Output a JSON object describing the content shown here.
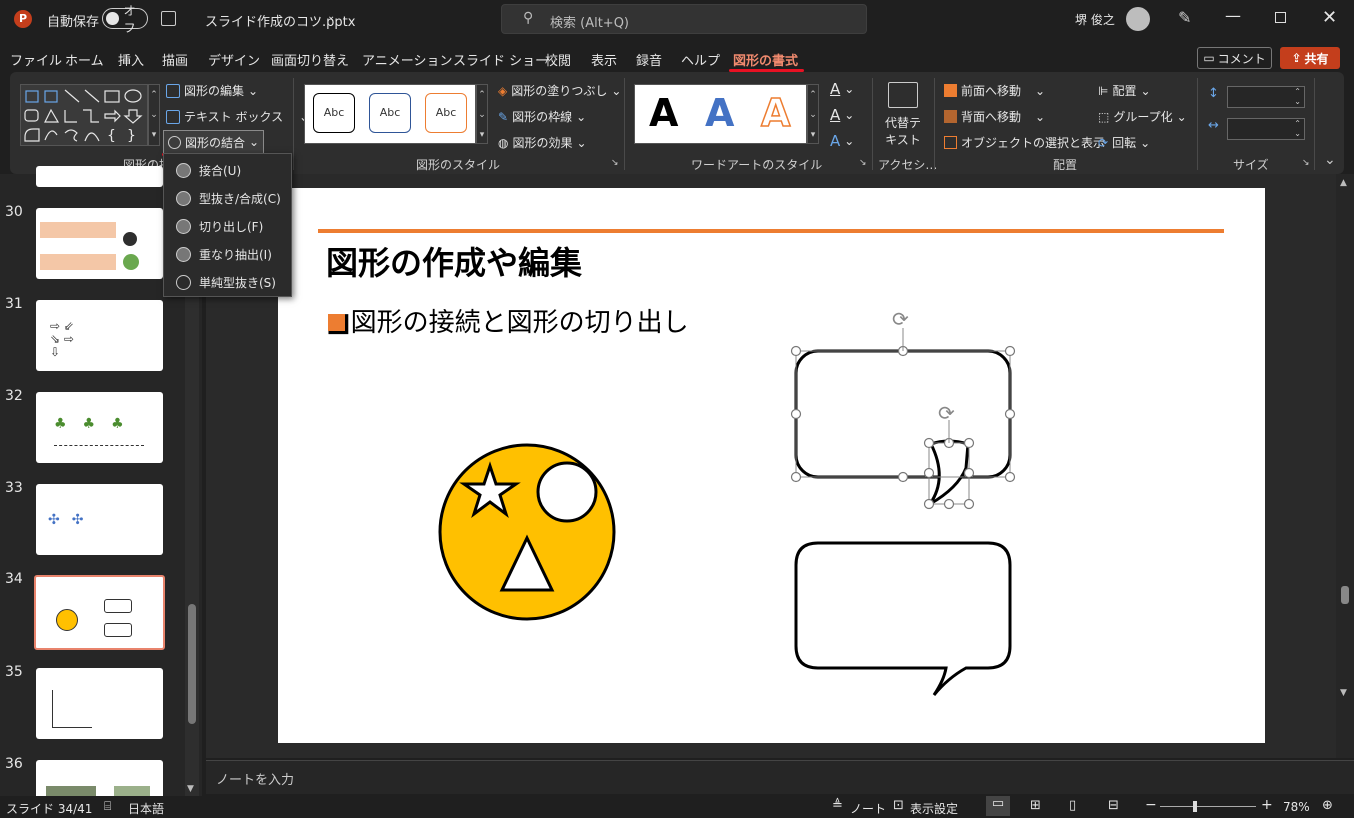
{
  "titlebar": {
    "autosave_label": "自動保存",
    "autosave_toggle": "オフ",
    "filename": "スライド作成のコツ.pptx",
    "search_placeholder": "検索 (Alt+Q)",
    "user_name": "堺 俊之"
  },
  "menu": {
    "tabs": [
      "ファイル",
      "ホーム",
      "挿入",
      "描画",
      "デザイン",
      "画面切り替え",
      "アニメーション",
      "スライド ショー",
      "校閲",
      "表示",
      "録音",
      "ヘルプ",
      "図形の書式"
    ],
    "comment_label": "コメント",
    "share_label": "共有"
  },
  "ribbon": {
    "insert_shapes": {
      "edit_shape": "図形の編集",
      "text_box": "テキスト ボックス",
      "merge_shapes": "図形の結合",
      "group_label": "図形の挿入"
    },
    "shape_styles": {
      "abc": "Abc",
      "fill": "図形の塗りつぶし",
      "outline": "図形の枠線",
      "effects": "図形の効果",
      "group_label": "図形のスタイル"
    },
    "wordart": {
      "letter": "A",
      "group_label": "ワードアートのスタイル"
    },
    "accessibility": {
      "alt_text_line1": "代替テ",
      "alt_text_line2": "キスト",
      "group_label": "アクセシ…"
    },
    "arrange": {
      "bring_forward": "前面へ移動",
      "send_backward": "背面へ移動",
      "selection_pane": "オブジェクトの選択と表示",
      "align": "配置",
      "group": "グループ化",
      "rotate": "回転",
      "group_label": "配置"
    },
    "size": {
      "group_label": "サイズ"
    }
  },
  "dropdown": {
    "items": [
      "接合(U)",
      "型抜き/合成(C)",
      "切り出し(F)",
      "重なり抽出(I)",
      "単純型抜き(S)"
    ]
  },
  "thumbnails": {
    "numbers": [
      "30",
      "31",
      "32",
      "33",
      "34",
      "35",
      "36"
    ],
    "active": "34"
  },
  "slide": {
    "title": "図形の作成や編集",
    "bullet": "■図形の接続と図形の切り出し"
  },
  "notes_placeholder": "ノートを入力",
  "status": {
    "slide_info": "スライド 34/41",
    "language": "日本語",
    "notes": "ノート",
    "display_settings": "表示設定",
    "zoom": "78%"
  },
  "colors": {
    "accent": "#c43e1c",
    "slide_orange": "#ed7d31",
    "shape_yellow": "#ffc000",
    "underline_red": "#e81123"
  }
}
